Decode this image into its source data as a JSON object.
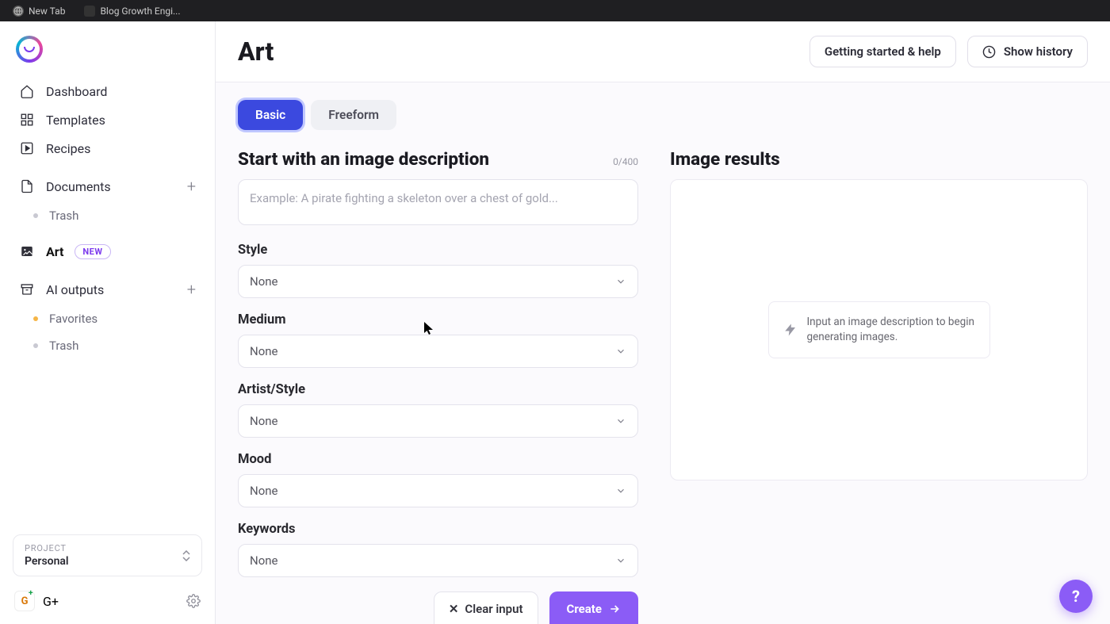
{
  "browser_tabs": [
    {
      "label": "New Tab"
    },
    {
      "label": "Blog Growth Engi..."
    }
  ],
  "sidebar": {
    "items": {
      "dashboard": "Dashboard",
      "templates": "Templates",
      "recipes": "Recipes",
      "documents": "Documents",
      "documents_trash": "Trash",
      "art": "Art",
      "art_badge": "NEW",
      "ai_outputs": "AI outputs",
      "favorites": "Favorites",
      "outputs_trash": "Trash"
    },
    "project": {
      "label": "PROJECT",
      "value": "Personal"
    },
    "user": "G+"
  },
  "header": {
    "title": "Art",
    "help_btn": "Getting started & help",
    "history_btn": "Show history"
  },
  "tabs": {
    "basic": "Basic",
    "freeform": "Freeform"
  },
  "form": {
    "description_title": "Start with an image description",
    "char_count": "0/400",
    "description_placeholder": "Example: A pirate fighting a skeleton over a chest of gold...",
    "style_label": "Style",
    "style_value": "None",
    "medium_label": "Medium",
    "medium_value": "None",
    "artist_label": "Artist/Style",
    "artist_value": "None",
    "mood_label": "Mood",
    "mood_value": "None",
    "keywords_label": "Keywords",
    "keywords_value": "None",
    "clear_btn": "Clear input",
    "create_btn": "Create"
  },
  "results": {
    "title": "Image results",
    "empty_text": "Input an image description to begin generating images."
  },
  "help_fab": "?"
}
